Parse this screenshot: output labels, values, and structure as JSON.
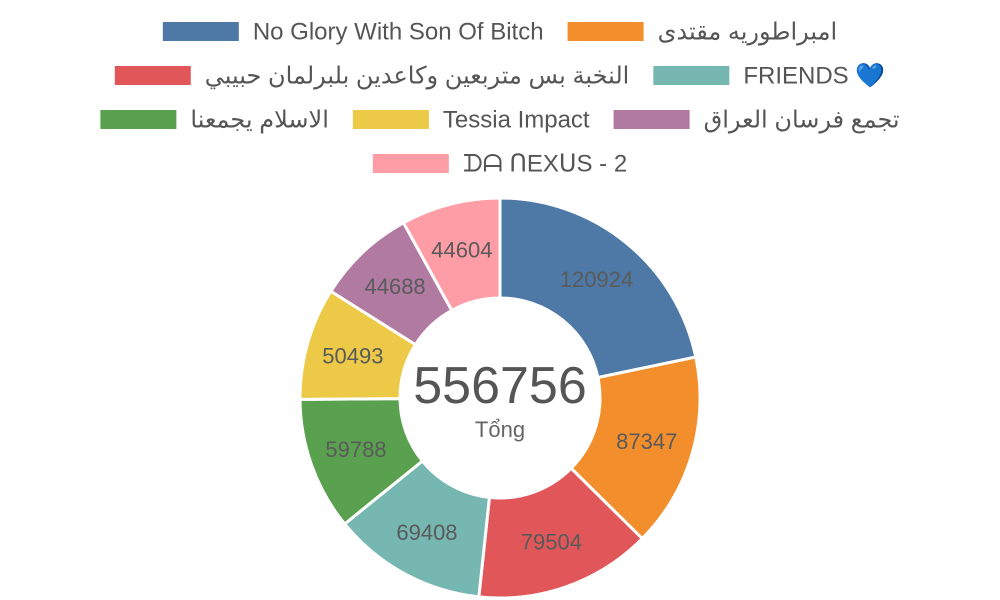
{
  "chart_data": {
    "type": "pie",
    "subtype": "donut",
    "legend_position": "top",
    "grid": false,
    "categories": [
      "No Glory With Son Of Bitch",
      "امبراطوريه مقتدى",
      "النخبة بس متربعين وكاعدين بلبرلمان حبيبي",
      "FRIENDS 💙",
      "الاسلام يجمعنا",
      "Tessia Impact",
      "تجمع فرسان العراق",
      "ᗪᗩ ᑎEXᑌS - 2"
    ],
    "values": [
      120924,
      87347,
      79504,
      69408,
      59788,
      50493,
      44688,
      44604
    ],
    "colors": [
      "#4e79a7",
      "#f28e2b",
      "#e15759",
      "#76b7b2",
      "#59a14f",
      "#edc948",
      "#b07aa1",
      "#ff9da7"
    ],
    "center_value": "556756",
    "center_label": "Tổng"
  }
}
